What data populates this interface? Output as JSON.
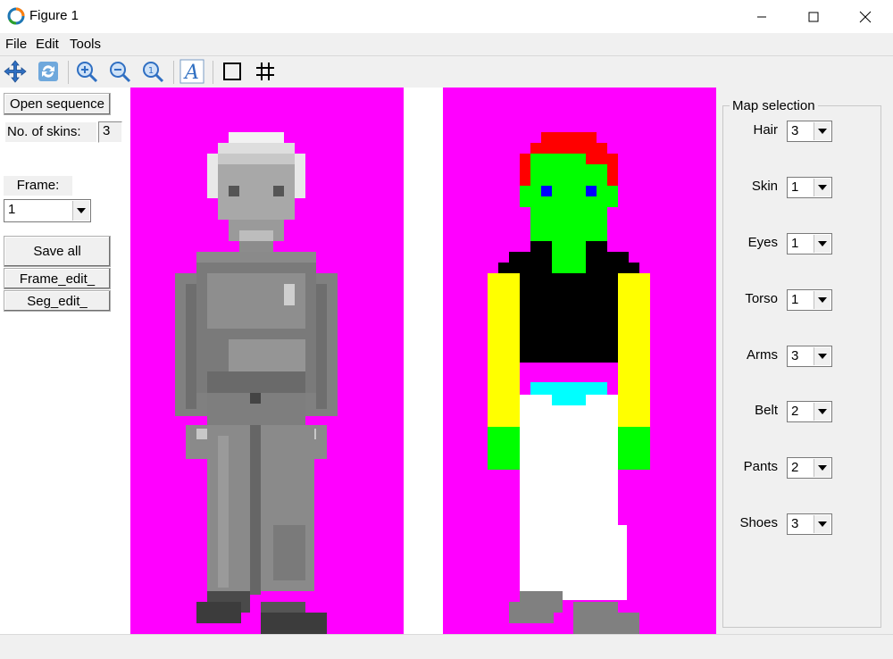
{
  "window": {
    "title": "Figure 1",
    "icons": {
      "app": "matplotlib-logo-icon",
      "minimize": "minimize-icon",
      "maximize": "maximize-icon",
      "close": "close-icon"
    }
  },
  "menu": {
    "file": "File",
    "edit": "Edit",
    "tools": "Tools"
  },
  "toolbar": {
    "icons": [
      "pan-icon",
      "refresh-icon",
      "zoom-in-icon",
      "zoom-out-icon",
      "zoom-fit-icon",
      "text-icon",
      "rectangle-icon",
      "grid-icon"
    ]
  },
  "left_panel": {
    "open_sequence": "Open sequence",
    "num_skins_label": "No. of skins:",
    "num_skins_value": "3",
    "frame_label": "Frame:",
    "frame_value": "1",
    "save_all": "Save all",
    "frame_edit": "Frame_edit_",
    "seg_edit": "Seg_edit_"
  },
  "map_selection": {
    "title": "Map selection",
    "rows": [
      {
        "label": "Hair",
        "value": "3"
      },
      {
        "label": "Skin",
        "value": "1"
      },
      {
        "label": "Eyes",
        "value": "1"
      },
      {
        "label": "Torso",
        "value": "1"
      },
      {
        "label": "Arms",
        "value": "3"
      },
      {
        "label": "Belt",
        "value": "2"
      },
      {
        "label": "Pants",
        "value": "2"
      },
      {
        "label": "Shoes",
        "value": "3"
      }
    ]
  },
  "colors": {
    "canvas_background": "#ff00ff",
    "hair": "#ff0000",
    "skin": "#00ff00",
    "eyes": "#0000ff",
    "torso": "#000000",
    "arms": "#ffff00",
    "belt": "#00ffff",
    "pants": "#ffffff",
    "shoes": "#808080"
  }
}
